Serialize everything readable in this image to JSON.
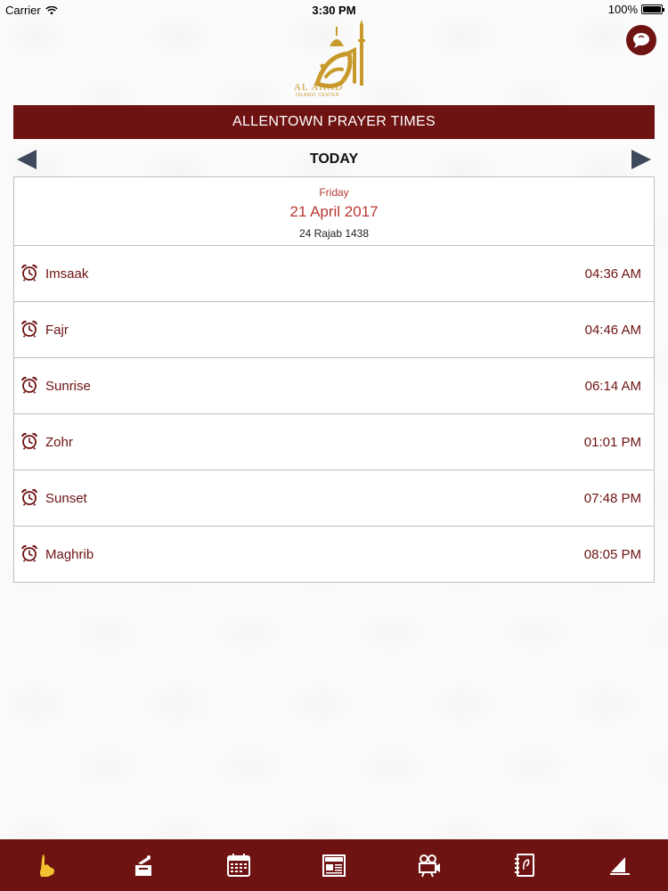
{
  "status_bar": {
    "carrier": "Carrier",
    "time": "3:30 PM",
    "battery": "100%"
  },
  "logo": {
    "name": "AL AHAD",
    "subtitle": "ISLAMIC CENTER",
    "color": "#c89a2c"
  },
  "header": {
    "title": "ALLENTOWN PRAYER TIMES"
  },
  "navigation": {
    "label": "TODAY"
  },
  "date": {
    "weekday": "Friday",
    "gregorian": "21 April 2017",
    "hijri": "24 Rajab 1438"
  },
  "prayers": [
    {
      "name": "Imsaak",
      "time": "04:36 AM"
    },
    {
      "name": "Fajr",
      "time": "04:46 AM"
    },
    {
      "name": "Sunrise",
      "time": "06:14 AM"
    },
    {
      "name": "Zohr",
      "time": "01:01 PM"
    },
    {
      "name": "Sunset",
      "time": "07:48 PM"
    },
    {
      "name": "Maghrib",
      "time": "08:05 PM"
    }
  ],
  "tabs": [
    {
      "icon": "prayer-hands-icon",
      "active": true
    },
    {
      "icon": "donation-box-icon",
      "active": false
    },
    {
      "icon": "calendar-icon",
      "active": false
    },
    {
      "icon": "news-icon",
      "active": false
    },
    {
      "icon": "video-camera-icon",
      "active": false
    },
    {
      "icon": "contact-book-icon",
      "active": false
    },
    {
      "icon": "sailboat-icon",
      "active": false
    }
  ],
  "colors": {
    "brand": "#6e1212",
    "accent_gold": "#f2c230",
    "date_red": "#b83a34"
  }
}
